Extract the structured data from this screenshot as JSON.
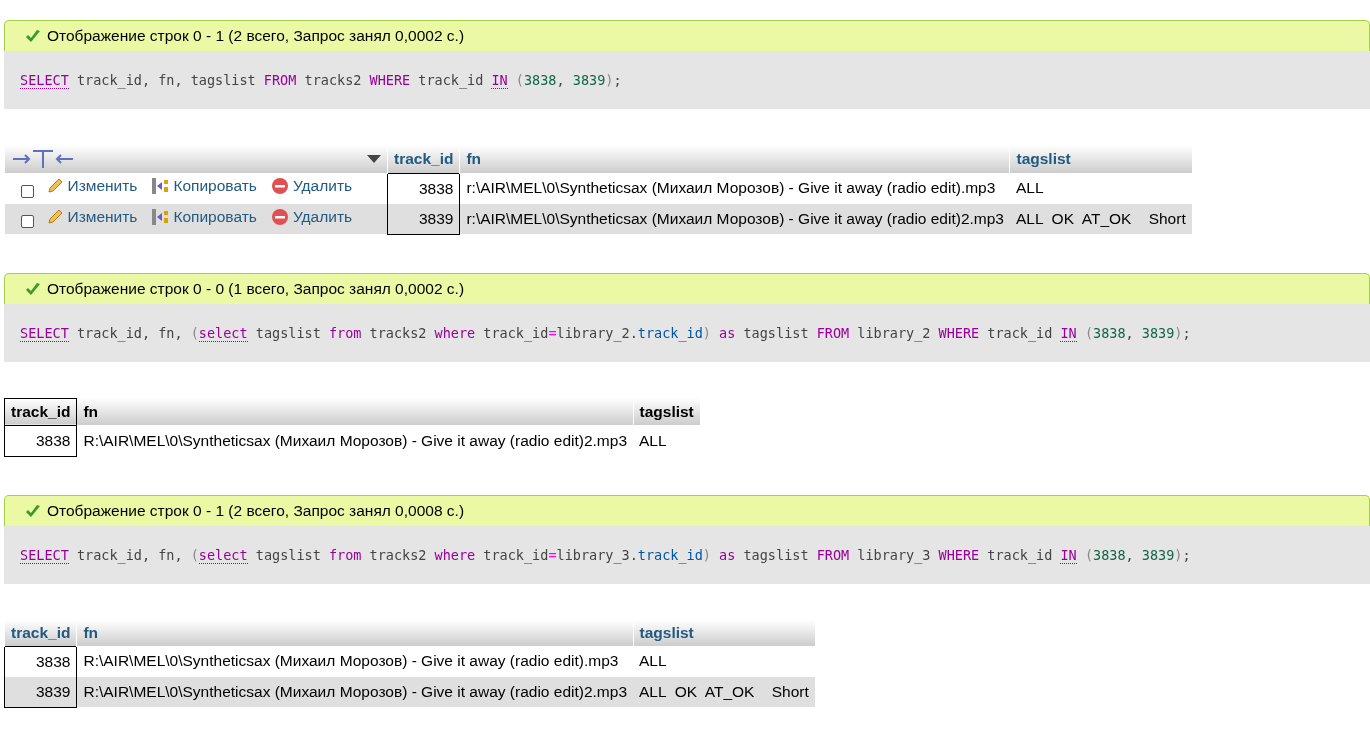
{
  "results": [
    {
      "message": "Отображение строк 0 - 1 (2 всего, Запрос занял 0,0002 с.)",
      "sql": [
        {
          "kind": "link",
          "text": "SELECT"
        },
        {
          "kind": "plain",
          "text": " track_id, fn, tagslist "
        },
        {
          "kind": "keyword",
          "text": "FROM"
        },
        {
          "kind": "plain",
          "text": " tracks2 "
        },
        {
          "kind": "keyword",
          "text": "WHERE"
        },
        {
          "kind": "plain",
          "text": " track_id "
        },
        {
          "kind": "link",
          "text": "IN"
        },
        {
          "kind": "paren",
          "text": " ("
        },
        {
          "kind": "number",
          "text": "3838"
        },
        {
          "kind": "plain",
          "text": ", "
        },
        {
          "kind": "number",
          "text": "3839"
        },
        {
          "kind": "paren",
          "text": ")"
        },
        {
          "kind": "plain",
          "text": ";"
        }
      ],
      "table": {
        "sortable": true,
        "columns": [
          {
            "label": "track_id",
            "outlined": true
          },
          {
            "label": "fn",
            "outlined": false
          },
          {
            "label": "tagslist",
            "outlined": false
          }
        ],
        "rows": [
          {
            "checked": false,
            "actions": {
              "edit": "Изменить",
              "copy": "Копировать",
              "delete": "Удалить"
            },
            "cells": [
              "3838",
              "r:\\AIR\\MEL\\0\\Syntheticsax (Михаил Морозов) - Give it away (radio edit).mp3",
              "ALL"
            ]
          },
          {
            "checked": false,
            "actions": {
              "edit": "Изменить",
              "copy": "Копировать",
              "delete": "Удалить"
            },
            "cells": [
              "3839",
              "r:\\AIR\\MEL\\0\\Syntheticsax (Михаил Морозов) - Give it away (radio edit)2.mp3",
              "ALL  OK  AT_OK    Short"
            ]
          }
        ]
      }
    },
    {
      "message": "Отображение строк 0 - 0 (1 всего, Запрос занял 0,0002 с.)",
      "sql": [
        {
          "kind": "link",
          "text": "SELECT"
        },
        {
          "kind": "plain",
          "text": " track_id, fn, "
        },
        {
          "kind": "paren",
          "text": "("
        },
        {
          "kind": "link",
          "text": "select"
        },
        {
          "kind": "plain",
          "text": " tagslist "
        },
        {
          "kind": "keyword",
          "text": "from"
        },
        {
          "kind": "plain",
          "text": " tracks2 "
        },
        {
          "kind": "keyword",
          "text": "where"
        },
        {
          "kind": "plain",
          "text": " track_id"
        },
        {
          "kind": "operator",
          "text": "="
        },
        {
          "kind": "plain",
          "text": "library_2."
        },
        {
          "kind": "field",
          "text": "track_id"
        },
        {
          "kind": "paren",
          "text": ") "
        },
        {
          "kind": "keyword",
          "text": "as"
        },
        {
          "kind": "plain",
          "text": " tagslist "
        },
        {
          "kind": "keyword",
          "text": "FROM"
        },
        {
          "kind": "plain",
          "text": " library_2 "
        },
        {
          "kind": "keyword",
          "text": "WHERE"
        },
        {
          "kind": "plain",
          "text": " track_id "
        },
        {
          "kind": "link",
          "text": "IN"
        },
        {
          "kind": "paren",
          "text": " ("
        },
        {
          "kind": "number",
          "text": "3838"
        },
        {
          "kind": "plain",
          "text": ", "
        },
        {
          "kind": "number",
          "text": "3839"
        },
        {
          "kind": "paren",
          "text": ")"
        },
        {
          "kind": "plain",
          "text": ";"
        }
      ],
      "table": {
        "sortable": false,
        "columns": [
          {
            "label": "track_id",
            "outlined": true
          },
          {
            "label": "fn",
            "outlined": false
          },
          {
            "label": "tagslist",
            "outlined": false
          }
        ],
        "rows": [
          {
            "cells": [
              "3838",
              "R:\\AIR\\MEL\\0\\Syntheticsax (Михаил Морозов) - Give it away (radio edit)2.mp3",
              "ALL"
            ]
          }
        ]
      }
    },
    {
      "message": "Отображение строк 0 - 1 (2 всего, Запрос занял 0,0008 с.)",
      "sql": [
        {
          "kind": "link",
          "text": "SELECT"
        },
        {
          "kind": "plain",
          "text": " track_id, fn, "
        },
        {
          "kind": "paren",
          "text": "("
        },
        {
          "kind": "link",
          "text": "select"
        },
        {
          "kind": "plain",
          "text": " tagslist "
        },
        {
          "kind": "keyword",
          "text": "from"
        },
        {
          "kind": "plain",
          "text": " tracks2 "
        },
        {
          "kind": "keyword",
          "text": "where"
        },
        {
          "kind": "plain",
          "text": " track_id"
        },
        {
          "kind": "operator",
          "text": "="
        },
        {
          "kind": "plain",
          "text": "library_3."
        },
        {
          "kind": "field",
          "text": "track_id"
        },
        {
          "kind": "paren",
          "text": ") "
        },
        {
          "kind": "keyword",
          "text": "as"
        },
        {
          "kind": "plain",
          "text": " tagslist "
        },
        {
          "kind": "keyword",
          "text": "FROM"
        },
        {
          "kind": "plain",
          "text": " library_3 "
        },
        {
          "kind": "keyword",
          "text": "WHERE"
        },
        {
          "kind": "plain",
          "text": " track_id "
        },
        {
          "kind": "link",
          "text": "IN"
        },
        {
          "kind": "paren",
          "text": " ("
        },
        {
          "kind": "number",
          "text": "3838"
        },
        {
          "kind": "plain",
          "text": ", "
        },
        {
          "kind": "number",
          "text": "3839"
        },
        {
          "kind": "paren",
          "text": ")"
        },
        {
          "kind": "plain",
          "text": ";"
        }
      ],
      "table": {
        "sortable": true,
        "columns": [
          {
            "label": "track_id",
            "outlined": true
          },
          {
            "label": "fn",
            "outlined": false
          },
          {
            "label": "tagslist",
            "outlined": false
          }
        ],
        "rows": [
          {
            "cells": [
              "3838",
              "R:\\AIR\\MEL\\0\\Syntheticsax (Михаил Морозов) - Give it away (radio edit).mp3",
              "ALL"
            ]
          },
          {
            "cells": [
              "3839",
              "R:\\AIR\\MEL\\0\\Syntheticsax (Михаил Морозов) - Give it away (radio edit)2.mp3",
              "ALL  OK  AT_OK    Short"
            ]
          }
        ]
      }
    }
  ]
}
